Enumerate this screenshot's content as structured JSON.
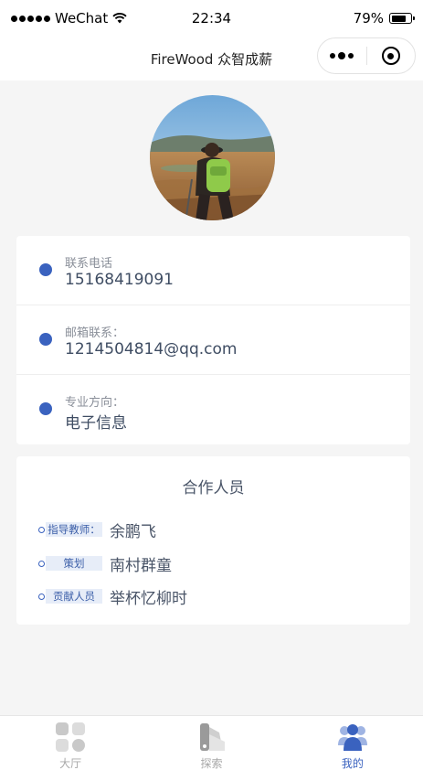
{
  "status_bar": {
    "carrier": "WeChat",
    "time": "22:34",
    "battery_percent": "79%",
    "battery_level": 0.79,
    "signal_icon": "signal-dots-icon",
    "wifi_icon": "wifi-icon"
  },
  "nav": {
    "title": "FireWood 众智成薪",
    "menu_icon": "more-dots-icon",
    "close_icon": "target-icon"
  },
  "profile": {
    "avatar_icon": "hiker-photo"
  },
  "contact": {
    "rows": [
      {
        "label": "联系电话",
        "value": "15168419091"
      },
      {
        "label": "邮箱联系：",
        "value": "1214504814@qq.com"
      },
      {
        "label": "专业方向：",
        "value": "电子信息"
      }
    ]
  },
  "team": {
    "title": "合作人员",
    "members": [
      {
        "role": "指导教师：",
        "name": "余鹏飞"
      },
      {
        "role": "策划",
        "name": "南村群童"
      },
      {
        "role": "贡献人员",
        "name": "举杯忆柳时"
      }
    ]
  },
  "tabbar": {
    "tabs": [
      {
        "label": "大厅",
        "icon": "hall-grid-icon"
      },
      {
        "label": "探索",
        "icon": "explore-fan-icon"
      },
      {
        "label": "我的",
        "icon": "people-icon"
      }
    ],
    "active_index": 2
  },
  "colors": {
    "accent": "#3a62bf",
    "tag_bg": "#e7edf8",
    "page_bg": "#f5f5f5"
  }
}
